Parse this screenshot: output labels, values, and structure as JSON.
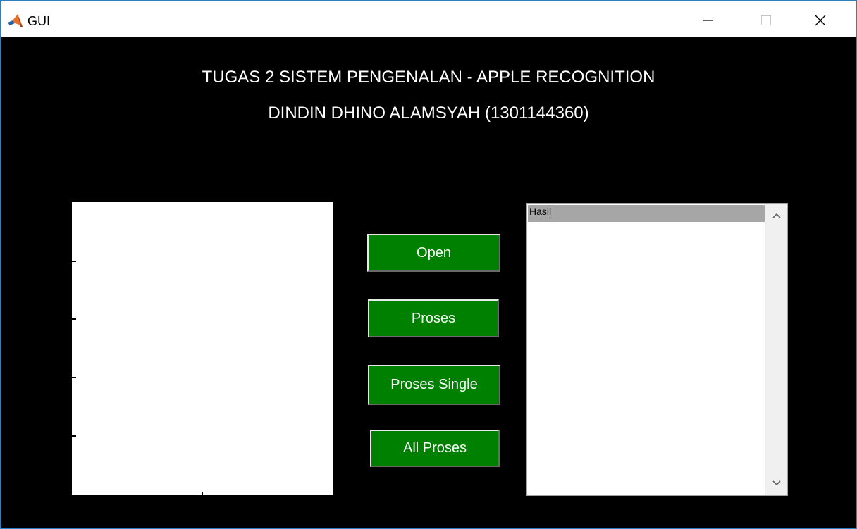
{
  "window": {
    "title": "GUI",
    "controls": {
      "minimize": "—",
      "maximize": "☐",
      "close": "✕"
    }
  },
  "header": {
    "title": "TUGAS 2 SISTEM PENGENALAN - APPLE RECOGNITION",
    "subtitle": "DINDIN DHINO ALAMSYAH (1301144360)"
  },
  "buttons": {
    "open": "Open",
    "proses": "Proses",
    "proses_single": "Proses Single",
    "all_proses": "All Proses"
  },
  "listbox": {
    "items": [
      "Hasil"
    ]
  },
  "colors": {
    "button_green": "#008000",
    "background": "#000000",
    "selected_item": "#a6a6a6"
  },
  "icons": {
    "app": "matlab-icon",
    "scroll_up": "chevron-up-icon",
    "scroll_down": "chevron-down-icon"
  }
}
